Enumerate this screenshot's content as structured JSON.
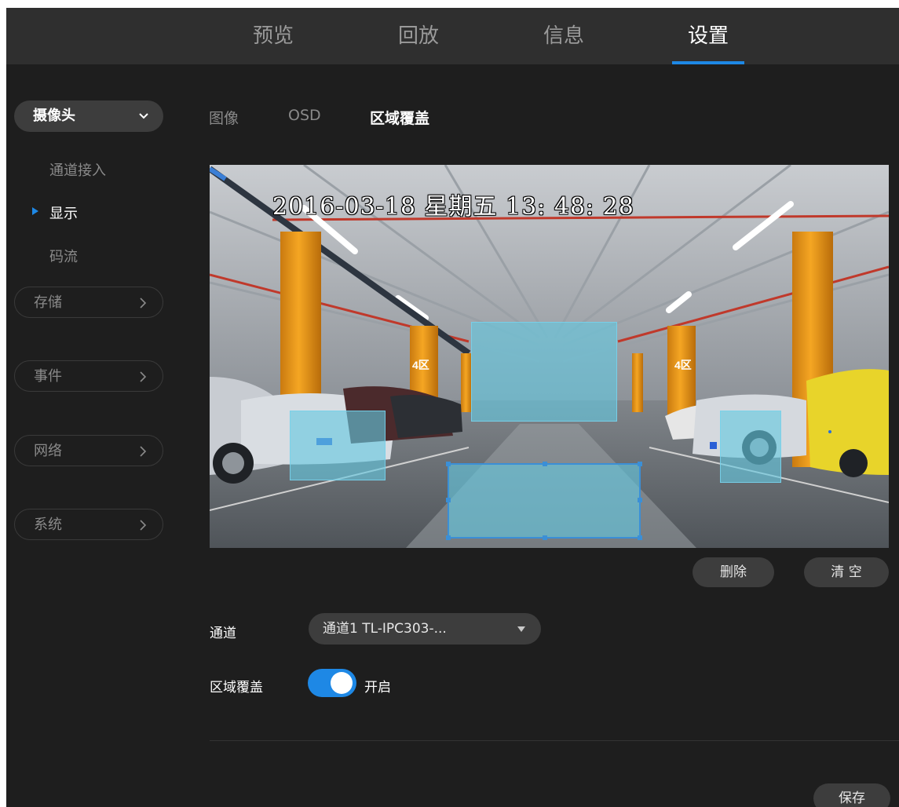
{
  "nav": {
    "tabs": [
      {
        "label": "预览",
        "active": false
      },
      {
        "label": "回放",
        "active": false
      },
      {
        "label": "信息",
        "active": false
      },
      {
        "label": "设置",
        "active": true
      }
    ]
  },
  "sidebar": {
    "camera_group": "摄像头",
    "camera_items": [
      "通道接入",
      "显示",
      "码流"
    ],
    "active_item": "显示",
    "groups": [
      "存储",
      "事件",
      "网络",
      "系统"
    ]
  },
  "subtabs": [
    {
      "label": "图像",
      "active": false
    },
    {
      "label": "OSD",
      "active": false
    },
    {
      "label": "区域覆盖",
      "active": true
    }
  ],
  "preview": {
    "osd_text": "2016-03-18 星期五 13: 48: 28",
    "privacy_masks": 4
  },
  "buttons": {
    "delete": "删除",
    "clear": "清 空",
    "save": "保存"
  },
  "form": {
    "channel_label": "通道",
    "channel_value": "通道1 TL-IPC303-...",
    "mask_label": "区域覆盖",
    "mask_toggle_on": true,
    "mask_toggle_text": "开启"
  },
  "colors": {
    "accent": "#1e88e5",
    "background": "#1e1e1e",
    "topbar": "#2f2f2f",
    "mask": "#64c8e1"
  }
}
